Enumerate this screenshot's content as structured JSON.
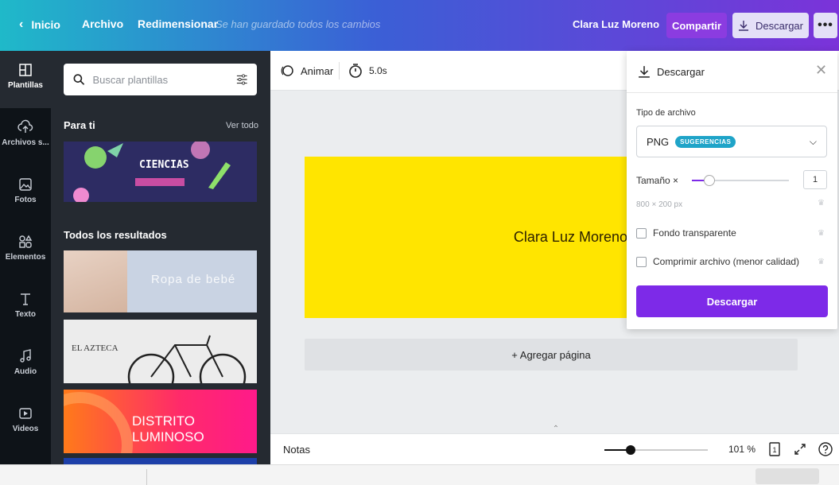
{
  "topbar": {
    "home_label": "Inicio",
    "file_label": "Archivo",
    "resize_label": "Redimensionar",
    "saved_status": "Se han guardado todos los cambios",
    "user_name": "Clara Luz Moreno",
    "share_label": "Compartir",
    "download_label": "Descargar",
    "more_label": "•••"
  },
  "rail": {
    "items": [
      {
        "label": "Plantillas",
        "icon": "template-icon"
      },
      {
        "label": "Archivos s...",
        "icon": "upload-icon"
      },
      {
        "label": "Fotos",
        "icon": "photo-icon"
      },
      {
        "label": "Elementos",
        "icon": "shapes-icon"
      },
      {
        "label": "Texto",
        "icon": "text-icon"
      },
      {
        "label": "Audio",
        "icon": "music-icon"
      },
      {
        "label": "Videos",
        "icon": "video-icon"
      }
    ]
  },
  "panel": {
    "search_placeholder": "Buscar plantillas",
    "for_you_title": "Para ti",
    "see_all": "Ver todo",
    "all_results_title": "Todos los resultados",
    "templates": {
      "ciencias": "CIENCIAS",
      "bebe": "Ropa de bebé",
      "azteca": "EL AZTECA",
      "distrito": "DISTRITO LUMINOSO"
    }
  },
  "editor": {
    "animate_label": "Animar",
    "duration": "5.0s",
    "canvas_text": "Clara Luz Moreno",
    "add_page": "+ Agregar página",
    "notes_label": "Notas",
    "zoom_value": "101 %",
    "zoom_fraction": 0.25,
    "page_count": "1",
    "canvas_color": "#ffe500"
  },
  "download_panel": {
    "title": "Descargar",
    "file_type_label": "Tipo de archivo",
    "file_type": "PNG",
    "badge": "SUGERENCIAS",
    "size_label": "Tamaño ×",
    "size_value": "1",
    "size_fraction": 0.18,
    "dimensions": "800 × 200 px",
    "transparent_label": "Fondo transparente",
    "compress_label": "Comprimir archivo (menor calidad)",
    "button_label": "Descargar",
    "accent": "#7d2ae8"
  }
}
